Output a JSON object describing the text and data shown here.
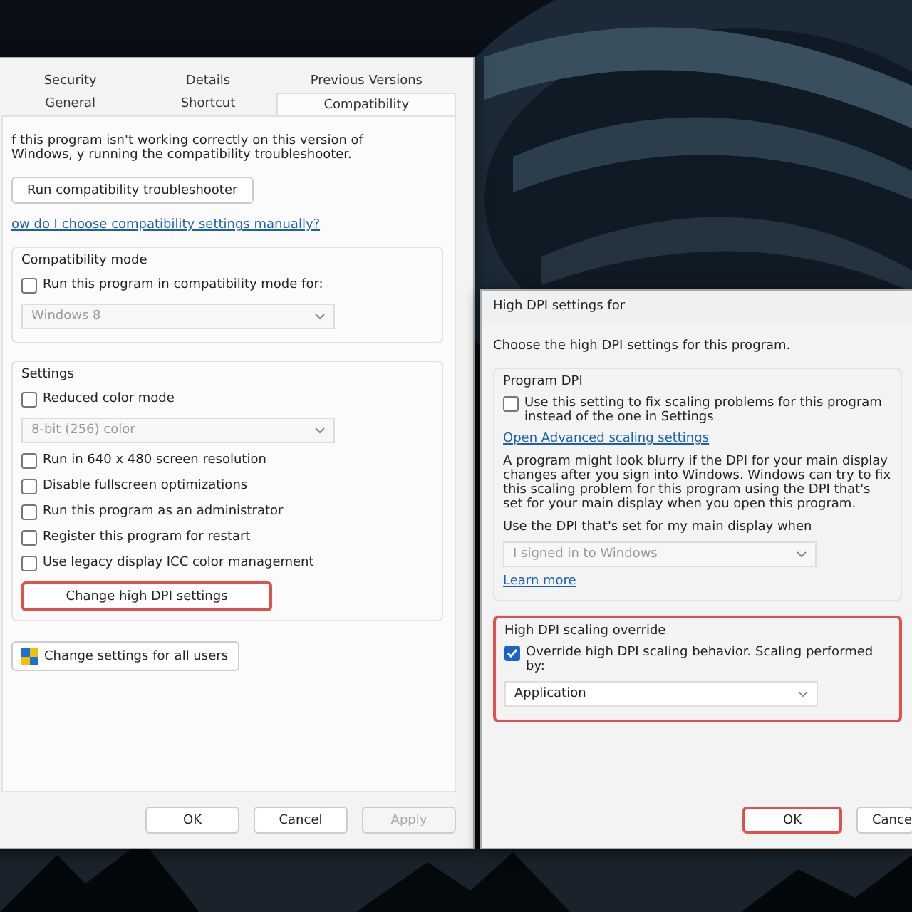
{
  "properties_dialog": {
    "tabs": [
      {
        "label": "Security",
        "selected": false
      },
      {
        "label": "Details",
        "selected": false
      },
      {
        "label": "Previous Versions",
        "selected": false
      },
      {
        "label": "General",
        "selected": false
      },
      {
        "label": "Shortcut",
        "selected": false
      },
      {
        "label": "Compatibility",
        "selected": true
      }
    ],
    "intro": "f this program isn't working correctly on this version of Windows, y running the compatibility troubleshooter.",
    "troubleshooter_button": "Run compatibility troubleshooter",
    "manual_link": "ow do I choose compatibility settings manually?",
    "compatibility_mode": {
      "title": "Compatibility mode",
      "items": [
        {
          "kind": "checkbox",
          "label": "Run this program in compatibility mode for:",
          "checked": false
        },
        {
          "kind": "dropdown",
          "value": "Windows 8",
          "disabled": true
        }
      ]
    },
    "settings": {
      "title": "Settings",
      "items": [
        {
          "kind": "checkbox",
          "label": "Reduced color mode",
          "checked": false
        },
        {
          "kind": "dropdown",
          "value": "8-bit (256) color",
          "disabled": true
        },
        {
          "kind": "checkbox",
          "label": "Run in 640 x 480 screen resolution",
          "checked": false
        },
        {
          "kind": "checkbox",
          "label": "Disable fullscreen optimizations",
          "checked": false
        },
        {
          "kind": "checkbox",
          "label": "Run this program as an administrator",
          "checked": false
        },
        {
          "kind": "checkbox",
          "label": "Register this program for restart",
          "checked": false
        },
        {
          "kind": "checkbox",
          "label": "Use legacy display ICC color management",
          "checked": false
        },
        {
          "kind": "button",
          "label": "Change high DPI settings",
          "highlighted": true
        }
      ]
    },
    "all_users_button": "Change settings for all users",
    "buttons": [
      {
        "label": "OK",
        "disabled": false
      },
      {
        "label": "Cancel",
        "disabled": false
      },
      {
        "label": "Apply",
        "disabled": true
      }
    ]
  },
  "dpi_dialog": {
    "title": "High DPI settings for",
    "heading": "Choose the high DPI settings for this program.",
    "groups": [
      {
        "title": "Program DPI",
        "highlighted": false,
        "items": [
          {
            "kind": "checkbox",
            "label": "Use this setting to fix scaling problems for this program instead of the one in Settings",
            "checked": false
          },
          {
            "kind": "link",
            "label": "Open Advanced scaling settings"
          },
          {
            "kind": "text",
            "label": "A program might look blurry if the DPI for your main display changes after you sign into Windows. Windows can try to fix this scaling problem for this program using the DPI that's set for your main display when you open this program."
          },
          {
            "kind": "text",
            "label": "Use the DPI that's set for my main display when"
          },
          {
            "kind": "dropdown",
            "value": "I signed in to Windows",
            "disabled": true
          },
          {
            "kind": "link",
            "label": "Learn more"
          }
        ]
      },
      {
        "title": "High DPI scaling override",
        "highlighted": true,
        "items": [
          {
            "kind": "checkbox",
            "label": "Override high DPI scaling behavior. Scaling performed by:",
            "checked": true
          },
          {
            "kind": "dropdown",
            "value": "Application",
            "disabled": false
          }
        ]
      }
    ],
    "buttons": [
      {
        "label": "OK",
        "highlighted": true
      },
      {
        "label": "Cance",
        "highlighted": false
      }
    ]
  }
}
